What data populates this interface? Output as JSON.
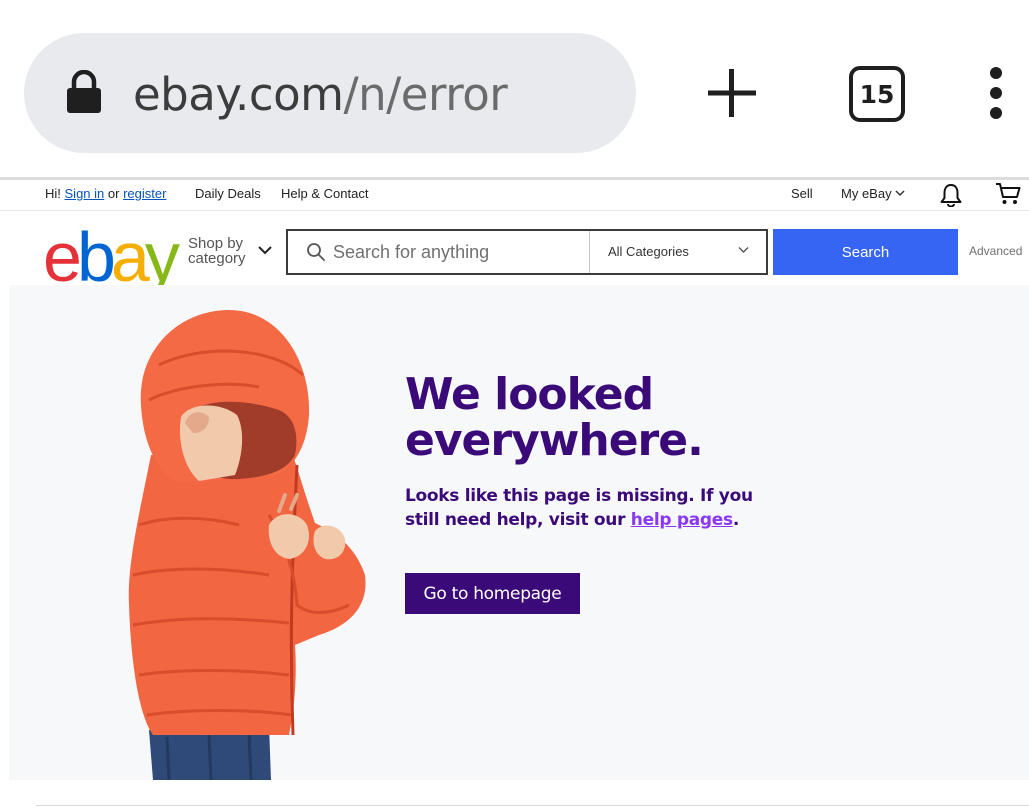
{
  "browser": {
    "url_domain": "ebay.com",
    "url_path": "/n/error",
    "tab_count": "15",
    "icons": [
      "lock-icon",
      "new-tab-plus-icon",
      "tab-switcher-icon",
      "more-options-icon"
    ]
  },
  "topnav": {
    "greeting": "Hi!",
    "sign_in": "Sign in",
    "or": "or",
    "register": "register",
    "daily_deals": "Daily Deals",
    "help_contact": "Help & Contact",
    "sell": "Sell",
    "my_ebay": "My eBay",
    "icons": [
      "bell-icon",
      "cart-icon"
    ]
  },
  "header": {
    "logo_letters": [
      "e",
      "b",
      "a",
      "y"
    ],
    "logo_colors": [
      "#e53238",
      "#0064d2",
      "#f5af02",
      "#86b817"
    ],
    "shop_by_line1": "Shop by",
    "shop_by_line2": "category",
    "search_placeholder": "Search for anything",
    "category_selected": "All Categories",
    "search_button": "Search",
    "advanced": "Advanced"
  },
  "error": {
    "headline_line1": "We looked",
    "headline_line2": "everywhere.",
    "message_part1": "Looks like this page is missing. If you still need help, visit our ",
    "help_link": "help pages",
    "message_end": ".",
    "home_button": "Go to homepage"
  },
  "colors": {
    "search_button": "#3665f3",
    "headline": "#3b0a79",
    "link": "#8a38f5",
    "hero_bg": "#f7f8fa"
  }
}
